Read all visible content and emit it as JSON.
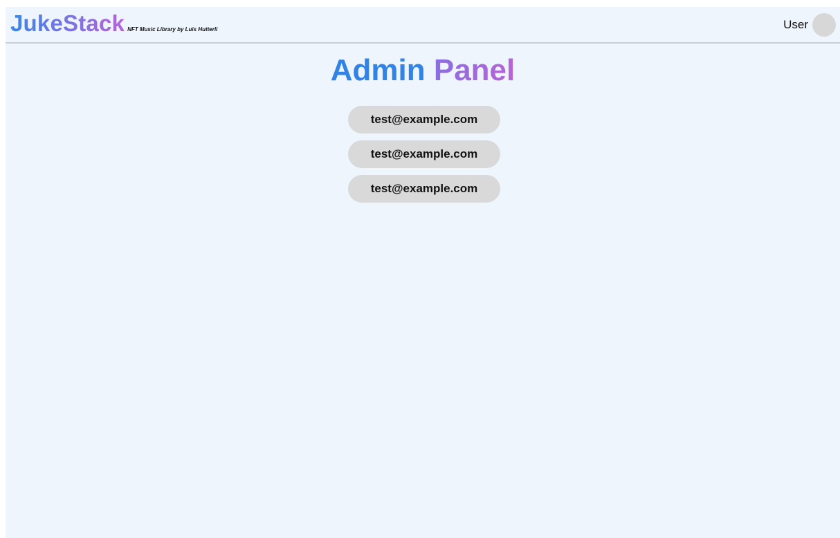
{
  "brand": {
    "name": "JukeStack",
    "tagline": "NFT Music Library by Luis Hutterli"
  },
  "header": {
    "user_label": "User"
  },
  "page": {
    "title_part1": "Admin",
    "title_part2": "Panel"
  },
  "users": [
    {
      "email": "test@example.com"
    },
    {
      "email": "test@example.com"
    },
    {
      "email": "test@example.com"
    }
  ],
  "colors": {
    "background": "#eef5fd",
    "accent_blue": "#3184e6",
    "accent_purple": "#b864d6",
    "pill": "#d9d9d9"
  }
}
